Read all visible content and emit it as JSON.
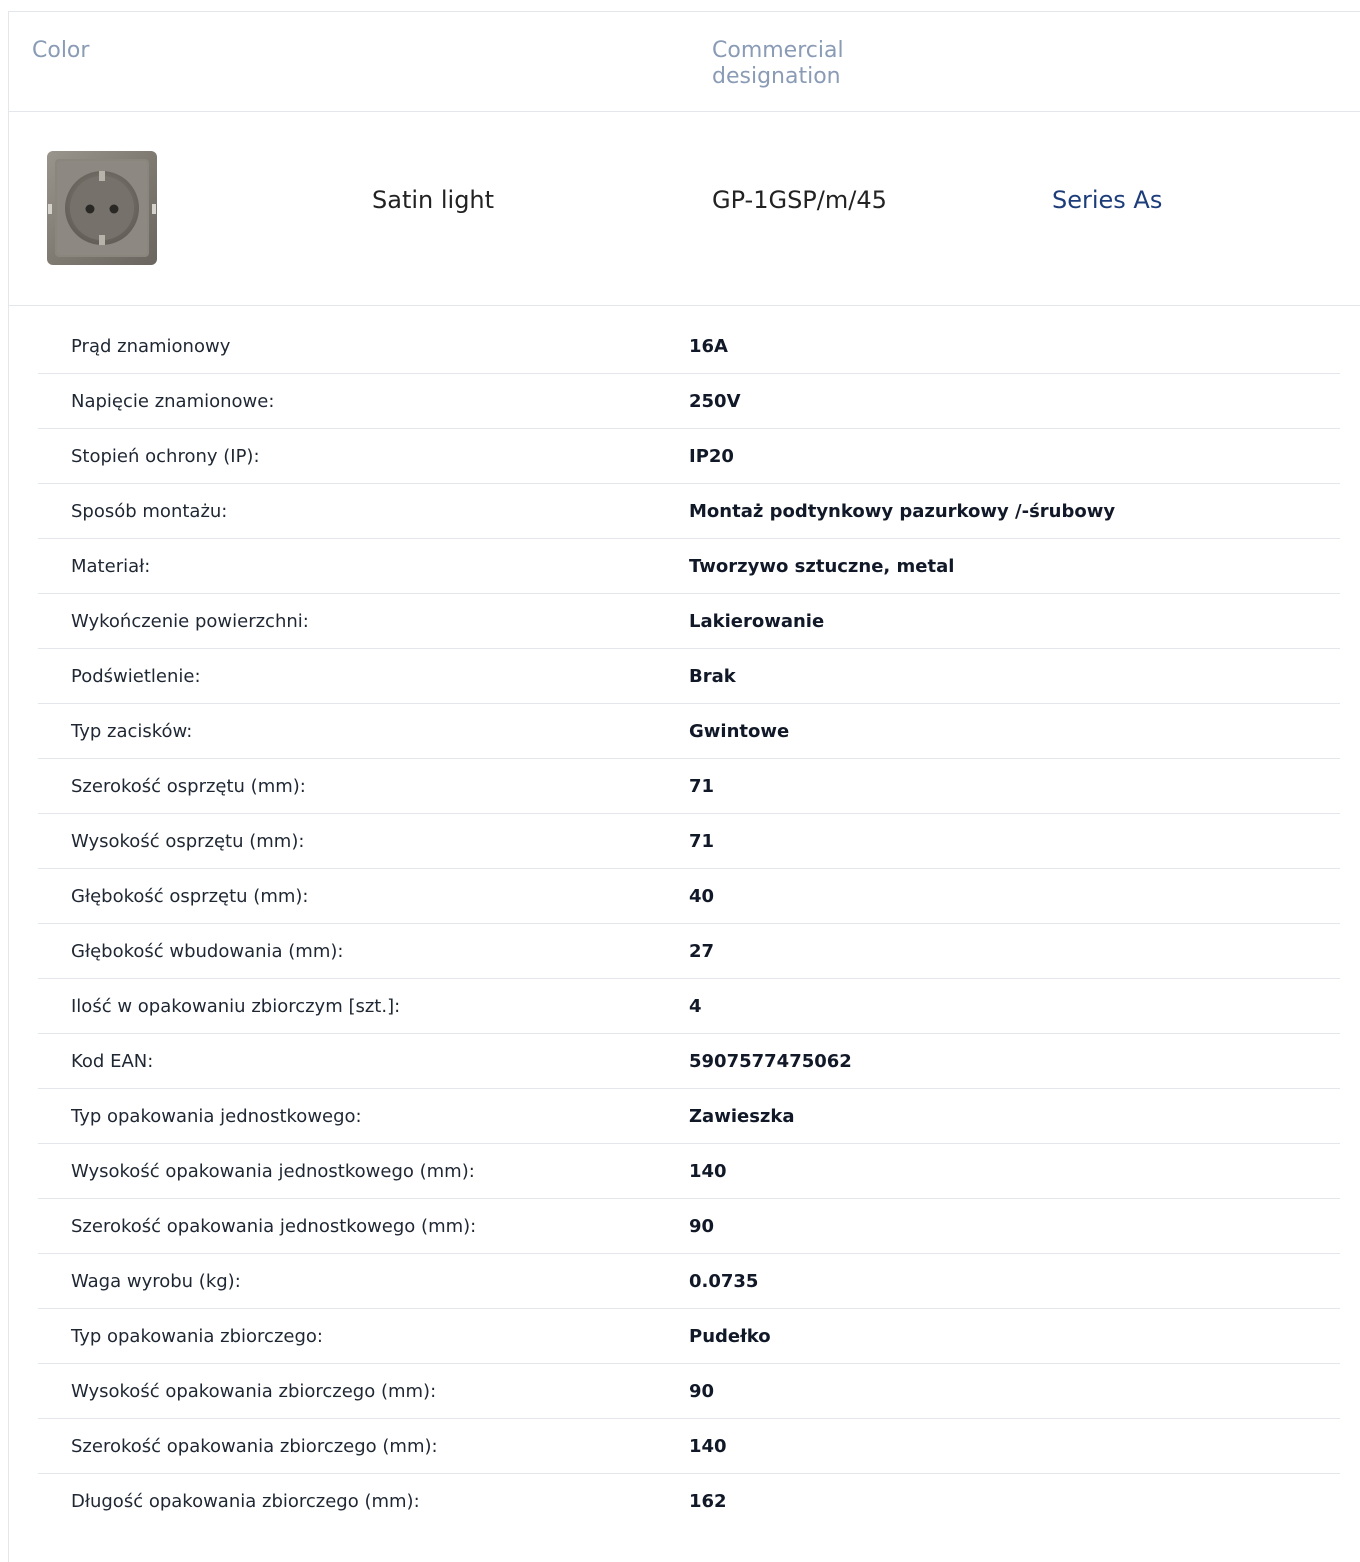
{
  "header": {
    "color_label": "Color",
    "commercial_label": "Commercial designation"
  },
  "product": {
    "image_icon": "socket-thumbnail",
    "color_name": "Satin light",
    "code": "GP-1GSP/m/45",
    "series_link": "Series As"
  },
  "specs": [
    {
      "label": "Prąd znamionowy",
      "value": "16A"
    },
    {
      "label": "Napięcie znamionowe:",
      "value": "250V"
    },
    {
      "label": "Stopień ochrony (IP):",
      "value": "IP20"
    },
    {
      "label": "Sposób montażu:",
      "value": "Montaż podtynkowy pazurkowy /-śrubowy"
    },
    {
      "label": "Materiał:",
      "value": "Tworzywo sztuczne, metal"
    },
    {
      "label": "Wykończenie powierzchni:",
      "value": "Lakierowanie"
    },
    {
      "label": "Podświetlenie:",
      "value": "Brak"
    },
    {
      "label": "Typ zacisków:",
      "value": "Gwintowe"
    },
    {
      "label": "Szerokość osprzętu (mm):",
      "value": "71"
    },
    {
      "label": "Wysokość osprzętu (mm):",
      "value": "71"
    },
    {
      "label": "Głębokość osprzętu (mm):",
      "value": "40"
    },
    {
      "label": "Głębokość wbudowania (mm):",
      "value": "27"
    },
    {
      "label": "Ilość w opakowaniu zbiorczym [szt.]:",
      "value": "4"
    },
    {
      "label": "Kod EAN:",
      "value": "5907577475062"
    },
    {
      "label": "Typ opakowania jednostkowego:",
      "value": "Zawieszka"
    },
    {
      "label": "Wysokość opakowania jednostkowego (mm):",
      "value": "140"
    },
    {
      "label": "Szerokość opakowania jednostkowego (mm):",
      "value": "90"
    },
    {
      "label": "Waga wyrobu (kg):",
      "value": "0.0735"
    },
    {
      "label": "Typ opakowania zbiorczego:",
      "value": "Pudełko"
    },
    {
      "label": "Wysokość opakowania zbiorczego (mm):",
      "value": "90"
    },
    {
      "label": "Szerokość opakowania zbiorczego (mm):",
      "value": "140"
    },
    {
      "label": "Długość opakowania zbiorczego (mm):",
      "value": "162"
    }
  ]
}
